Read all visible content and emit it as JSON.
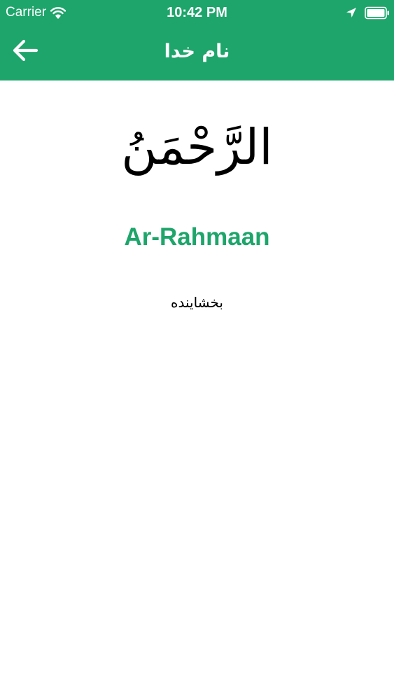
{
  "status_bar": {
    "carrier": "Carrier",
    "time": "10:42 PM",
    "icons": [
      "wifi-icon",
      "location-arrow-icon",
      "battery-icon"
    ]
  },
  "nav": {
    "back_icon": "arrow-left-icon",
    "title": "نام خدا"
  },
  "name": {
    "arabic": "الرَّحْمَنُ",
    "transliteration": "Ar-Rahmaan",
    "meaning": "بخشاینده"
  },
  "colors": {
    "header": "#1ea56b",
    "accent": "#1ea56b",
    "background": "#ffffff",
    "text": "#000000"
  }
}
